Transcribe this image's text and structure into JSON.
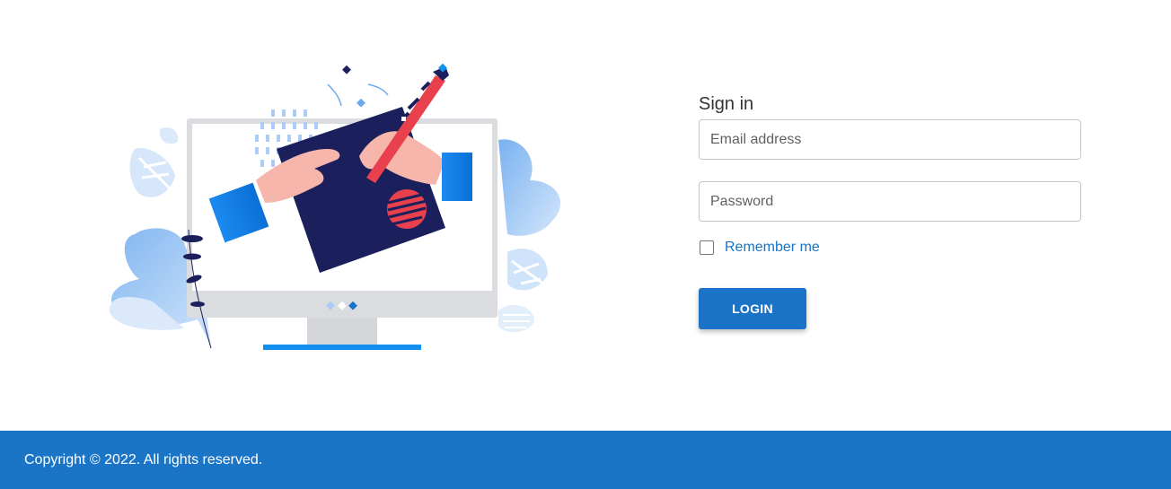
{
  "form": {
    "title": "Sign in",
    "email_placeholder": "Email address",
    "email_value": "",
    "password_placeholder": "Password",
    "password_value": "",
    "remember_label": "Remember me",
    "remember_checked": false,
    "login_label": "LOGIN"
  },
  "footer": {
    "copyright": "Copyright © 2022. All rights reserved."
  },
  "colors": {
    "primary": "#1a73c6",
    "footer_bg": "#1a75c6",
    "illustration_navy": "#1b1f5c",
    "illustration_red": "#e8404c",
    "illustration_light_blue": "#a9cdf5"
  },
  "illustration": {
    "icons": [
      "monitor-icon",
      "tablet-icon",
      "stylus-icon",
      "hand-icon",
      "leaf-icon"
    ]
  }
}
